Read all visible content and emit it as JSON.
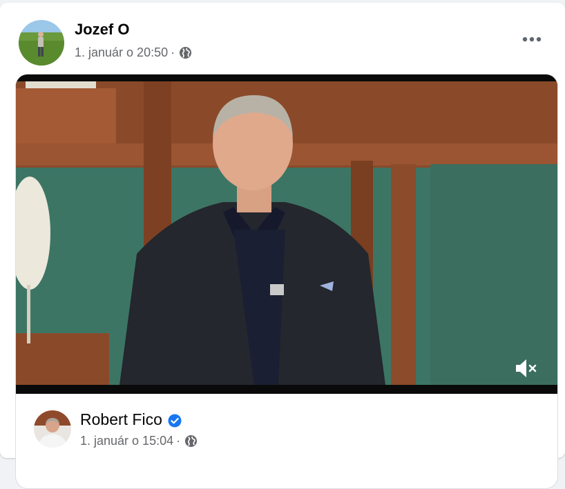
{
  "post": {
    "author": "Jozef O",
    "date": "1. január o 20:50",
    "separator": "·",
    "privacy_icon": "globe-icon",
    "more_icon": "more-options-icon"
  },
  "shared_post": {
    "author": "Robert Fico",
    "verified_icon": "verified-badge-icon",
    "date": "1. január o 15:04",
    "separator": "·",
    "privacy_icon": "globe-icon"
  },
  "video": {
    "mute_icon": "volume-muted-icon"
  },
  "colors": {
    "name_text": "#050505",
    "meta_text": "#65676b",
    "verified": "#1877f2",
    "card_bg": "#ffffff",
    "page_bg": "#f0f2f5"
  }
}
